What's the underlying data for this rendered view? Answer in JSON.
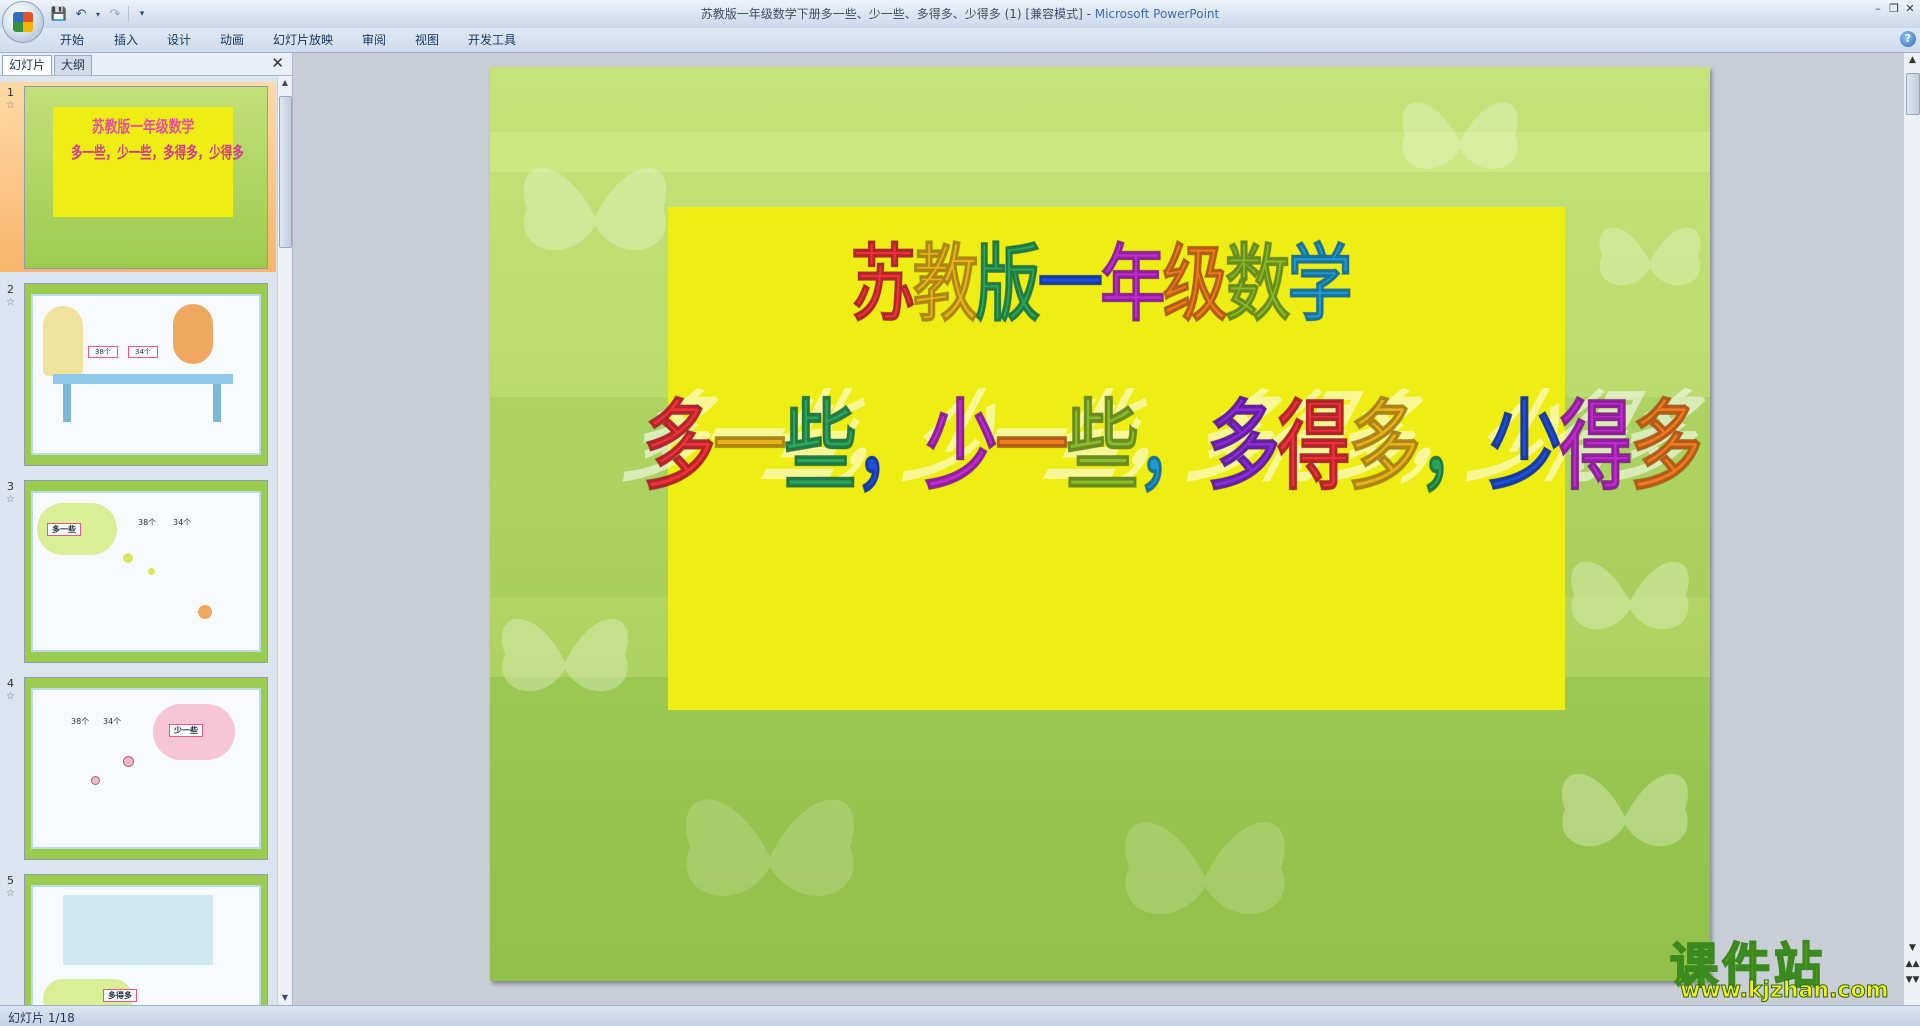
{
  "window": {
    "title": "苏教版一年级数学下册多一些、少一些、多得多、少得多 (1) [兼容模式] - ",
    "app_name": "Microsoft PowerPoint"
  },
  "quick_access": [
    "save-icon",
    "undo-icon",
    "redo-icon",
    "customize-icon"
  ],
  "ribbon": {
    "tabs": [
      "开始",
      "插入",
      "设计",
      "动画",
      "幻灯片放映",
      "审阅",
      "视图",
      "开发工具"
    ]
  },
  "left_pane": {
    "tabs": [
      "幻灯片",
      "大纲"
    ],
    "active_tab": "幻灯片",
    "thumbnails": [
      {
        "num": "1",
        "selected": true
      },
      {
        "num": "2",
        "labels": [
          "38个",
          "34个"
        ]
      },
      {
        "num": "3",
        "labels": [
          "多一些",
          "38个",
          "34个"
        ]
      },
      {
        "num": "4",
        "labels": [
          "38个",
          "34个",
          "少一些"
        ]
      },
      {
        "num": "5",
        "labels": [
          "多得多"
        ]
      }
    ]
  },
  "slide": {
    "title_line1": "苏教版一年级数学",
    "title_line2": "多一些，少一些，多得多，少得多",
    "colors": {
      "background": "#b6d96a",
      "box": "#eeee14"
    }
  },
  "status": {
    "text": "幻灯片 1/18"
  },
  "watermark": {
    "main": "课件站",
    "url": "www.kjzhan.com"
  }
}
